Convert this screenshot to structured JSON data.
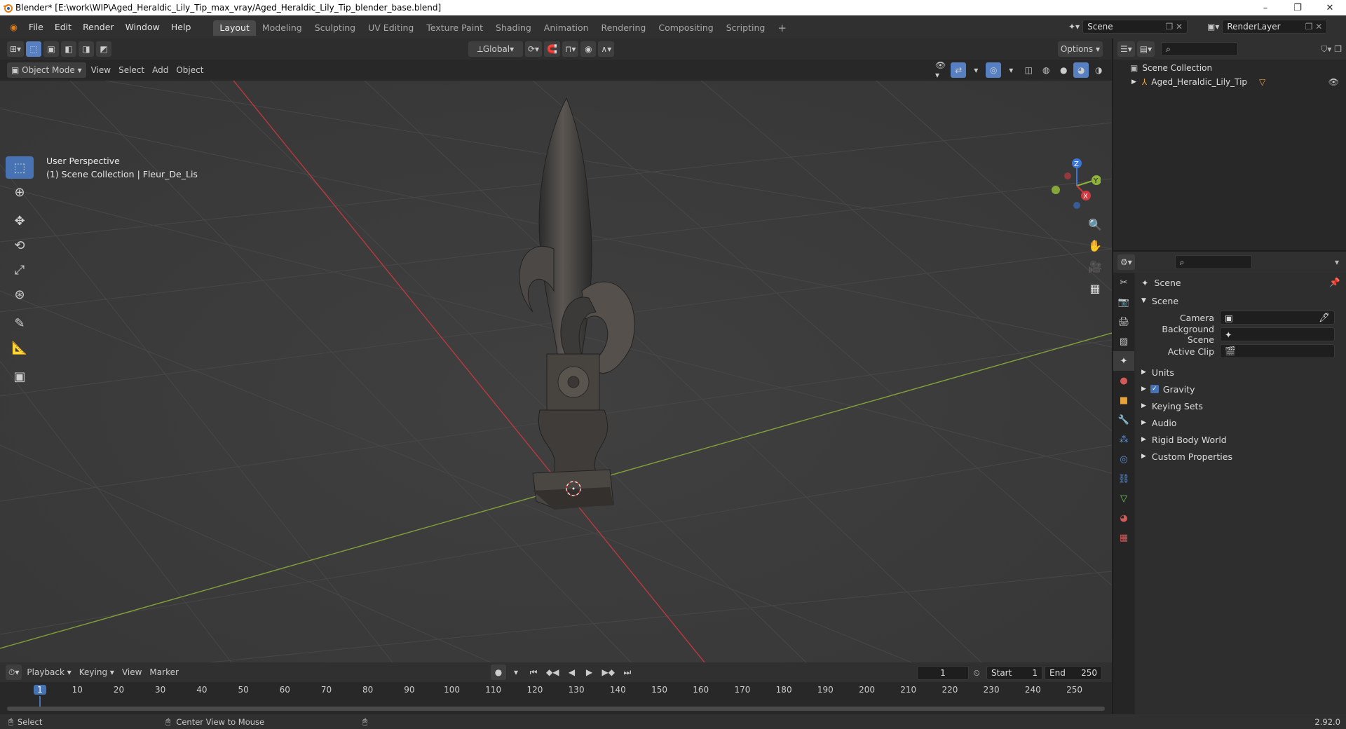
{
  "window": {
    "title": "Blender* [E:\\work\\WIP\\Aged_Heraldic_Lily_Tip_max_vray/Aged_Heraldic_Lily_Tip_blender_base.blend]",
    "controls": [
      "–",
      "❐",
      "✕"
    ]
  },
  "menu": [
    "File",
    "Edit",
    "Render",
    "Window",
    "Help"
  ],
  "workspaces": [
    "Layout",
    "Modeling",
    "Sculpting",
    "UV Editing",
    "Texture Paint",
    "Shading",
    "Animation",
    "Rendering",
    "Compositing",
    "Scripting"
  ],
  "active_workspace": "Layout",
  "scene_selector": {
    "value": "Scene"
  },
  "view_layer": {
    "value": "RenderLayer"
  },
  "viewport": {
    "mode": "Object Mode",
    "menus": [
      "View",
      "Select",
      "Add",
      "Object"
    ],
    "orientation": "Global",
    "options_label": "Options",
    "info_line1": "User Perspective",
    "info_line2": "(1) Scene Collection | Fleur_De_Lis",
    "gizmo": {
      "x": "X",
      "y": "Y",
      "z": "Z"
    }
  },
  "outliner": {
    "root": "Scene Collection",
    "items": [
      {
        "label": "Aged_Heraldic_Lily_Tip"
      }
    ]
  },
  "properties": {
    "context": "Scene",
    "panel_title": "Scene",
    "fields": [
      {
        "label": "Camera",
        "value": ""
      },
      {
        "label": "Background Scene",
        "value": ""
      },
      {
        "label": "Active Clip",
        "value": ""
      }
    ],
    "subpanels": [
      {
        "label": "Units",
        "checkbox": false
      },
      {
        "label": "Gravity",
        "checkbox": true
      },
      {
        "label": "Keying Sets",
        "checkbox": false
      },
      {
        "label": "Audio",
        "checkbox": false
      },
      {
        "label": "Rigid Body World",
        "checkbox": false
      },
      {
        "label": "Custom Properties",
        "checkbox": false
      }
    ]
  },
  "timeline": {
    "menus": [
      "Playback",
      "Keying",
      "View",
      "Marker"
    ],
    "current_frame": "1",
    "start_label": "Start",
    "start_value": "1",
    "end_label": "End",
    "end_value": "250",
    "ruler": [
      "1",
      "10",
      "20",
      "30",
      "40",
      "50",
      "60",
      "70",
      "80",
      "90",
      "100",
      "110",
      "120",
      "130",
      "140",
      "150",
      "160",
      "170",
      "180",
      "190",
      "200",
      "210",
      "220",
      "230",
      "240",
      "250"
    ]
  },
  "status": {
    "select": "Select",
    "center": "Center View to Mouse",
    "version": "2.92.0"
  },
  "colors": {
    "accent": "#4772b3",
    "x_axis": "#d0393f",
    "y_axis": "#8fb33a",
    "z_axis": "#3b75d6"
  }
}
